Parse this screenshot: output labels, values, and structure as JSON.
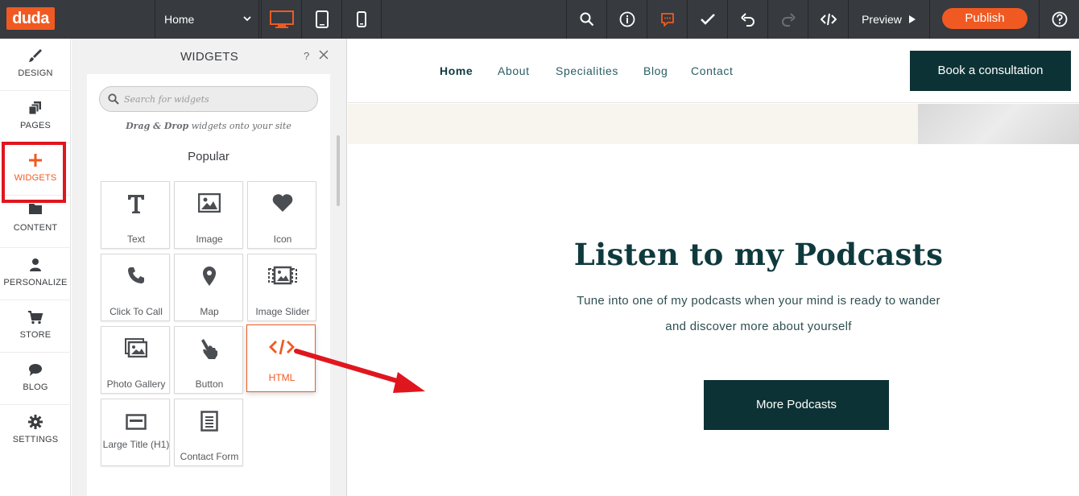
{
  "topbar": {
    "logo": "duda",
    "page_select": "Home",
    "preview_label": "Preview",
    "publish_label": "Publish",
    "accent": "#f05a22",
    "icons": [
      "desktop-icon",
      "tablet-icon",
      "mobile-icon",
      "search-icon",
      "info-icon",
      "comments-icon",
      "check-icon",
      "undo-icon",
      "redo-icon",
      "code-icon",
      "help-icon"
    ]
  },
  "leftnav": {
    "items": [
      {
        "label": "DESIGN",
        "icon": "brush-icon"
      },
      {
        "label": "PAGES",
        "icon": "pages-icon"
      },
      {
        "label": "WIDGETS",
        "icon": "plus-icon"
      },
      {
        "label": "CONTENT",
        "icon": "folder-icon"
      },
      {
        "label": "PERSONALIZE",
        "icon": "person-icon"
      },
      {
        "label": "STORE",
        "icon": "cart-icon"
      },
      {
        "label": "BLOG",
        "icon": "chat-icon"
      },
      {
        "label": "SETTINGS",
        "icon": "gear-icon"
      }
    ]
  },
  "panel": {
    "title": "WIDGETS",
    "help": "?",
    "search_placeholder": "Search for widgets",
    "drag_bold": "Drag & Drop",
    "drag_rest": " widgets onto your site",
    "section": "Popular",
    "widgets": [
      {
        "label": "Text",
        "icon": "text-icon"
      },
      {
        "label": "Image",
        "icon": "image-icon"
      },
      {
        "label": "Icon",
        "icon": "heart-icon"
      },
      {
        "label": "Click To Call",
        "icon": "phone-icon"
      },
      {
        "label": "Map",
        "icon": "map-pin-icon"
      },
      {
        "label": "Image Slider",
        "icon": "image-slider-icon"
      },
      {
        "label": "Photo Gallery",
        "icon": "photo-gallery-icon"
      },
      {
        "label": "Button",
        "icon": "pointer-hand-icon"
      },
      {
        "label": "HTML",
        "icon": "code-icon"
      },
      {
        "label": "Large Title (H1)",
        "icon": "title-icon"
      },
      {
        "label": "Contact Form",
        "icon": "form-icon"
      }
    ]
  },
  "site": {
    "nav": [
      "Home",
      "About",
      "Specialities",
      "Blog",
      "Contact"
    ],
    "cta": "Book a consultation",
    "headline": "Listen to my Podcasts",
    "sub_line1": "Tune into one of my podcasts when your mind is ready to wander",
    "sub_line2": "and discover more about yourself",
    "button": "More Podcasts",
    "dark": "#0c3235"
  }
}
